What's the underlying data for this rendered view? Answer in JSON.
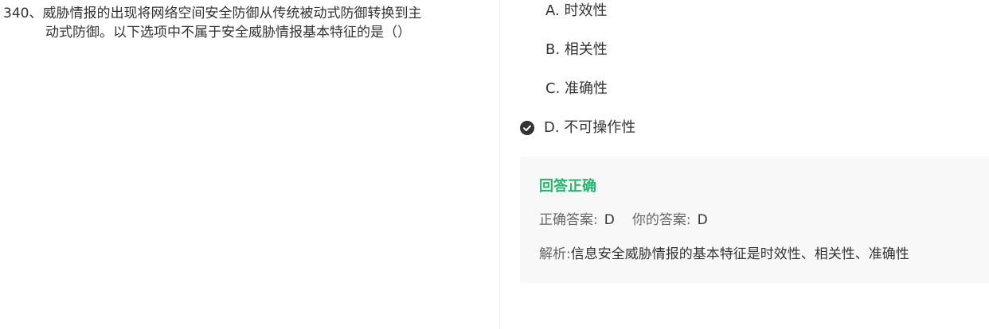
{
  "question": {
    "line1": "340、威胁情报的出现将网络空间安全防御从传统被动式防御转换到主",
    "line2": "动式防御。以下选项中不属于安全威胁情报基本特征的是（）"
  },
  "options": [
    {
      "label": "A. 时效性",
      "selected": false
    },
    {
      "label": "B. 相关性",
      "selected": false
    },
    {
      "label": "C. 准确性",
      "selected": false
    },
    {
      "label": "D. 不可操作性",
      "selected": true
    }
  ],
  "icons": {
    "selected": "check-circle-icon"
  },
  "result": {
    "title": "回答正确",
    "correct_label": "正确答案:",
    "correct_value": "D",
    "your_label": "你的答案:",
    "your_value": "D",
    "analysis_label": "解析:",
    "analysis_text": "信息安全威胁情报的基本特征是时效性、相关性、准确性"
  },
  "colors": {
    "success": "#1fb86b",
    "panel_bg": "#f8f8f8",
    "icon": "#333333"
  }
}
